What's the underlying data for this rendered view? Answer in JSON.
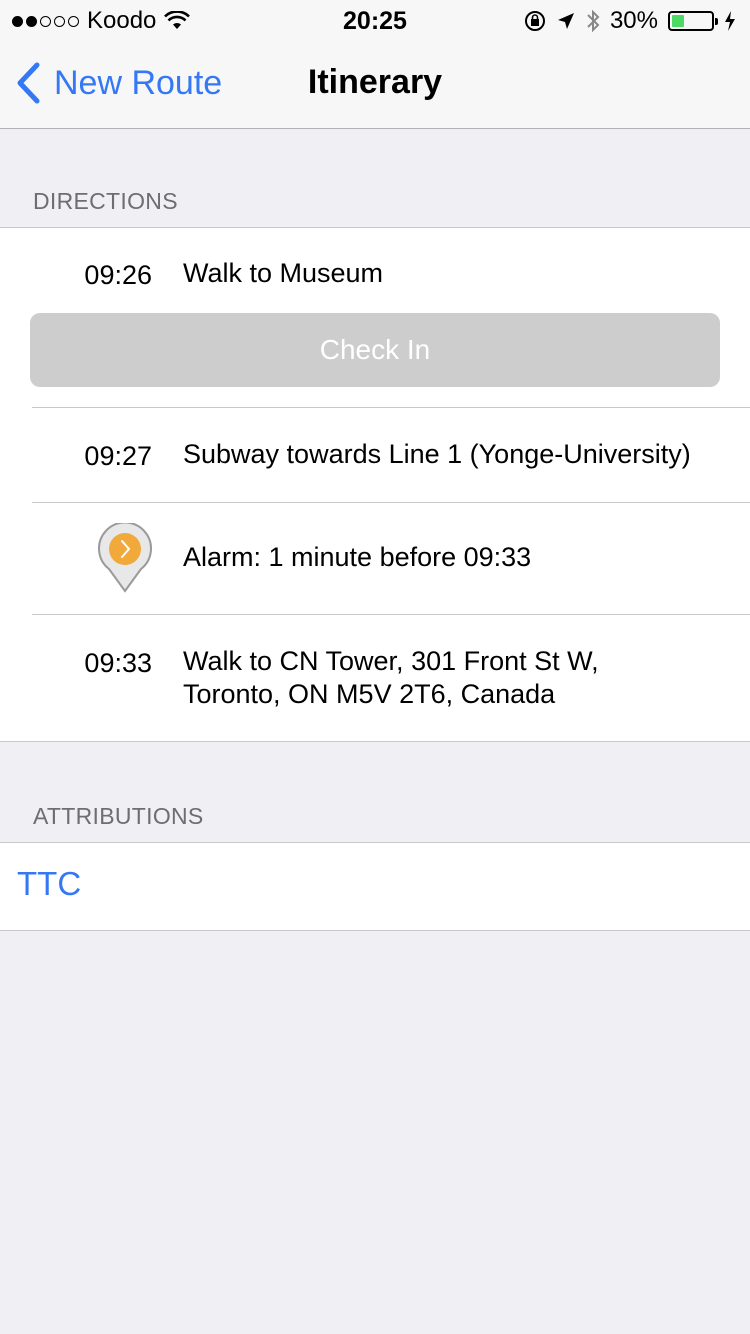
{
  "status_bar": {
    "carrier": "Koodo",
    "time": "20:25",
    "battery_percent": "30%",
    "battery_level": 0.3,
    "signal_bars_filled": 2,
    "signal_bars_total": 5
  },
  "nav": {
    "back_label": "New Route",
    "title": "Itinerary"
  },
  "directions": {
    "header": "DIRECTIONS",
    "steps": [
      {
        "time": "09:26",
        "text": "Walk to Museum"
      },
      {
        "time": "09:27",
        "text": "Subway towards Line 1 (Yonge-University)"
      },
      {
        "time": "",
        "text": "Alarm: 1 minute before 09:33"
      },
      {
        "time": "09:33",
        "text_line1": "Walk to CN Tower, 301 Front St W,",
        "text_line2": "Toronto, ON M5V 2T6, Canada"
      }
    ],
    "check_in_label": "Check In"
  },
  "attributions": {
    "header": "ATTRIBUTIONS",
    "items": [
      "TTC"
    ]
  },
  "colors": {
    "accent": "#3478f6",
    "alarm_pin": "#f0a93a",
    "battery": "#4cd964",
    "background": "#efeff4"
  },
  "icons": [
    "wifi-icon",
    "orientation-lock-icon",
    "location-arrow-icon",
    "bluetooth-icon",
    "battery-icon",
    "charging-bolt-icon",
    "back-chevron-icon",
    "alarm-pin-icon"
  ]
}
